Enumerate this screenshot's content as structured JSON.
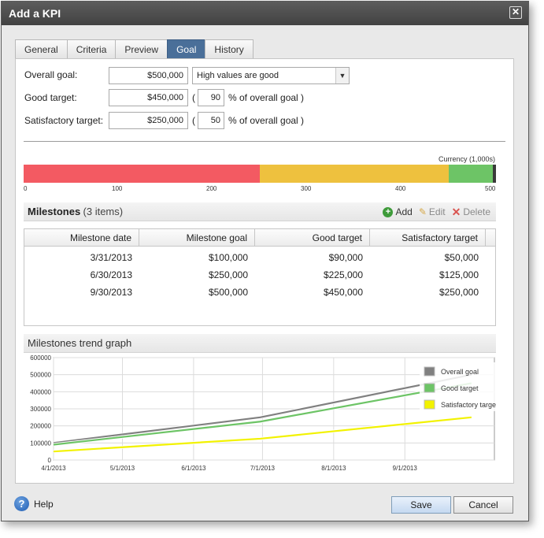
{
  "dialog": {
    "title": "Add a KPI",
    "close_glyph": "✕"
  },
  "tabs": [
    {
      "label": "General"
    },
    {
      "label": "Criteria"
    },
    {
      "label": "Preview"
    },
    {
      "label": "Goal"
    },
    {
      "label": "History"
    }
  ],
  "goal_form": {
    "overall_goal_label": "Overall goal:",
    "overall_goal_value": "$500,000",
    "direction_value": "High values are good",
    "good_target_label": "Good target:",
    "good_target_value": "$450,000",
    "good_target_percent": "90",
    "satisfactory_target_label": "Satisfactory target:",
    "satisfactory_target_value": "$250,000",
    "satisfactory_target_percent": "50",
    "open_paren": "(",
    "percent_suffix": "% of overall goal )"
  },
  "range_bar": {
    "currency_label": "Currency (1,000s)",
    "ticks": [
      "0",
      "100",
      "200",
      "300",
      "400",
      "500"
    ],
    "max": 500,
    "segments": [
      {
        "from": 0,
        "to": 250,
        "color": "#f35a62"
      },
      {
        "from": 250,
        "to": 450,
        "color": "#eec13e"
      },
      {
        "from": 450,
        "to": 497,
        "color": "#6dc466"
      },
      {
        "from": 497,
        "to": 500,
        "color": "#3a3a3a"
      }
    ]
  },
  "milestones": {
    "title": "Milestones",
    "count": "(3 items)",
    "add_label": "Add",
    "edit_label": "Edit",
    "delete_label": "Delete",
    "columns": [
      "Milestone date",
      "Milestone goal",
      "Good target",
      "Satisfactory target"
    ],
    "rows": [
      [
        "3/31/2013",
        "$100,000",
        "$90,000",
        "$50,000"
      ],
      [
        "6/30/2013",
        "$250,000",
        "$225,000",
        "$125,000"
      ],
      [
        "9/30/2013",
        "$500,000",
        "$450,000",
        "$250,000"
      ]
    ]
  },
  "trend": {
    "title": "Milestones trend graph"
  },
  "chart_data": {
    "type": "line",
    "x": [
      "4/1/2013",
      "5/1/2013",
      "6/1/2013",
      "7/1/2013",
      "8/1/2013",
      "9/1/2013"
    ],
    "y_ticks": [
      "0",
      "100000",
      "200000",
      "300000",
      "400000",
      "500000",
      "600000"
    ],
    "ylim": [
      0,
      600000
    ],
    "xlim": [
      "4/1/2013",
      "10/10/2013"
    ],
    "grid": true,
    "legend_position": "top-right",
    "series": [
      {
        "name": "Overall goal",
        "color": "#808080",
        "points": [
          [
            "4/1/2013",
            100000
          ],
          [
            "6/30/2013",
            250000
          ],
          [
            "9/30/2013",
            500000
          ]
        ]
      },
      {
        "name": "Good target",
        "color": "#6dc466",
        "points": [
          [
            "4/1/2013",
            90000
          ],
          [
            "6/30/2013",
            225000
          ],
          [
            "9/30/2013",
            450000
          ]
        ]
      },
      {
        "name": "Satisfactory target",
        "color": "#f2f200",
        "points": [
          [
            "4/1/2013",
            50000
          ],
          [
            "6/30/2013",
            125000
          ],
          [
            "9/30/2013",
            250000
          ]
        ]
      }
    ]
  },
  "footer": {
    "help_label": "Help",
    "help_glyph": "?",
    "save_label": "Save",
    "cancel_label": "Cancel"
  }
}
